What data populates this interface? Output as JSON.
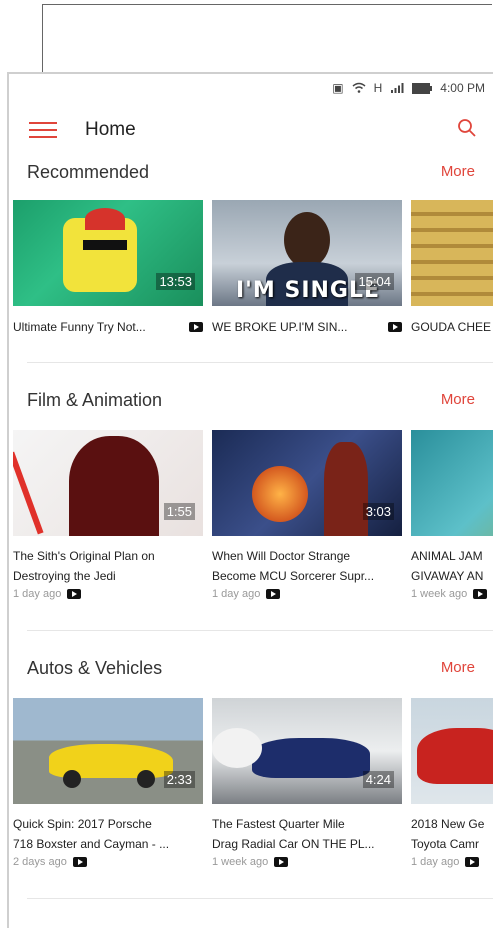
{
  "status_bar": {
    "time": "4:00 PM",
    "network": "H",
    "icons": [
      "nfc-icon",
      "wifi-icon",
      "signal-icon",
      "battery-icon"
    ]
  },
  "app_bar": {
    "title": "Home"
  },
  "sections": [
    {
      "title": "Recommended",
      "more_label": "More",
      "videos": [
        {
          "title": "Ultimate Funny Try Not...",
          "duration": "13:53"
        },
        {
          "title": "WE BROKE UP.I'M SIN...",
          "duration": "15:04",
          "overlay": "I'M SINGLE"
        },
        {
          "title": "GOUDA CHEE",
          "duration": ""
        }
      ]
    },
    {
      "title": "Film & Animation",
      "more_label": "More",
      "videos": [
        {
          "line1": "The Sith's Original Plan on",
          "line2": "Destroying the Jedi",
          "age": "1 day ago",
          "duration": "1:55"
        },
        {
          "line1": "When Will Doctor Strange",
          "line2": "Become MCU Sorcerer Supr...",
          "age": "1 day ago",
          "duration": "3:03"
        },
        {
          "line1": "ANIMAL JAM",
          "line2": "GIVAWAY AN",
          "age": "1 week ago",
          "duration": ""
        }
      ]
    },
    {
      "title": "Autos & Vehicles",
      "more_label": "More",
      "videos": [
        {
          "line1": "Quick Spin: 2017 Porsche",
          "line2": "718 Boxster and Cayman - ...",
          "age": "2 days ago",
          "duration": "2:33"
        },
        {
          "line1": "The Fastest Quarter Mile",
          "line2": "Drag Radial Car ON THE PL...",
          "age": "1 week ago",
          "duration": "4:24"
        },
        {
          "line1": "2018 New Ge",
          "line2": "Toyota Camr",
          "age": "1 day ago",
          "duration": ""
        }
      ]
    }
  ],
  "colors": {
    "accent": "#e0453b"
  }
}
